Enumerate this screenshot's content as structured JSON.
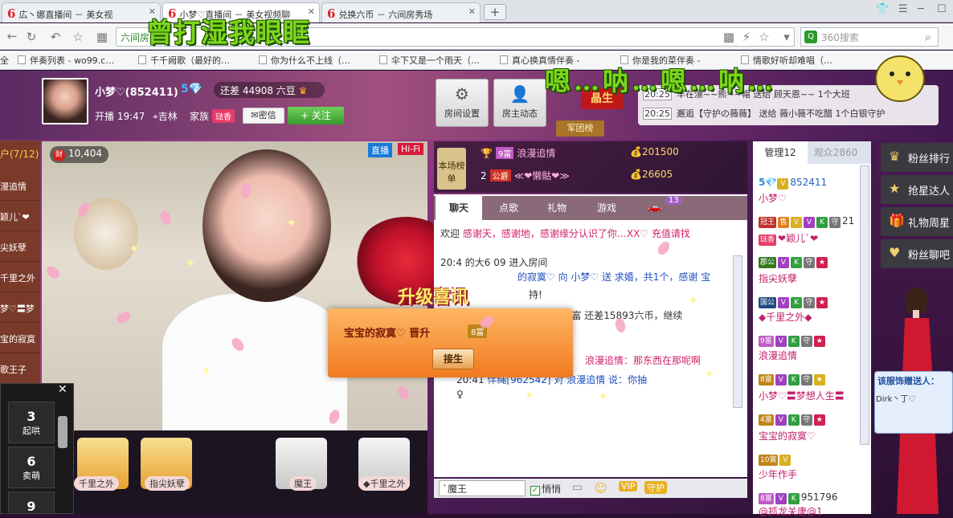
{
  "browser": {
    "tabs": [
      {
        "label": "広丶娜直播间 － 美女视",
        "active": false
      },
      {
        "label": "小梦♡直播间 － 美女视频聊",
        "active": true
      },
      {
        "label": "兑换六币 － 六间房秀场",
        "active": false
      }
    ],
    "new_tab": "+",
    "url": "六间房",
    "search_placeholder": "360搜索",
    "bookmarks": [
      "全",
      "伴奏列表 - wo99.c…",
      "千千阙歌（最好的…",
      "你为什么不上线（…",
      "伞下又是一个雨天（…",
      "真心换真情伴奏 -",
      "你是我的菜伴奏 -",
      "情歌好听却难唱（…"
    ]
  },
  "overlay": {
    "title": "曾打湿我眼眶",
    "subtitle": "嗯…呐…嗯…呐…"
  },
  "host": {
    "name": "小梦♡(852411)",
    "level": "5",
    "gap_text": "还差 44908 六豆",
    "open_time": "开播 19:47",
    "location": "吉林",
    "family_label": "家族",
    "family_badge": "琺香",
    "message_button": "密信",
    "follow_button": "+ 关注"
  },
  "header_buttons": {
    "room_settings": "房间设置",
    "host_feed": "房主动态"
  },
  "rank_badge": "晶生",
  "military_rank": "军团榜",
  "ticker": [
    {
      "time": "20:25",
      "text": "羊在漂~~熊~~帽 送给 顾天恩~~ 1个大班"
    },
    {
      "time": "20:25",
      "text": "邂逅【守护の薇薇】 送给 薇小薇不吃醋 1个白银守护"
    }
  ],
  "left_column": {
    "header": "户(7/12)",
    "items": [
      "漫追情",
      "颖儿`❤",
      "尖妖孽",
      "千里之外",
      "梦♡〓梦",
      "宝的寂寞",
      "歌王子"
    ]
  },
  "video": {
    "wealth": "10,404",
    "wealth_icon": "财",
    "live_tag": "直播",
    "hifi_tag": "Hi-Fi"
  },
  "keypad": {
    "close": "✕",
    "keys": [
      {
        "num": "3",
        "label": "起哄"
      },
      {
        "num": "6",
        "label": "卖萌"
      },
      {
        "num": "9",
        "label": ""
      }
    ]
  },
  "gift_tray": [
    {
      "label": "千里之外"
    },
    {
      "label": "指尖妖孽"
    },
    {
      "label": "魔王"
    },
    {
      "label": "◆千里之外"
    }
  ],
  "board": {
    "label": "本场榜单",
    "rows": [
      {
        "rank": "1",
        "level": "9富",
        "name": "浪漫追情",
        "points": "201500"
      },
      {
        "rank": "2",
        "level": "公爵",
        "name": "≪❤懒骷❤≫",
        "points": "26605"
      }
    ]
  },
  "chat": {
    "tabs": [
      "聊天",
      "点歌",
      "礼物",
      "游戏"
    ],
    "car_count": "13",
    "lines": [
      {
        "a": "欢迎",
        "b": "感谢天，感谢地，感谢缘分认识了你…XX♡ 充值请找"
      },
      {
        "a": "20:4",
        "b": "的大6 09 进入房间"
      },
      {
        "a": "",
        "b": "的寂寞♡ 向 小梦♡ 送 求婚，共1个，感谢 宝"
      },
      {
        "a": "",
        "b": "持!"
      },
      {
        "a": "",
        "b": "距 7富 还差15893六币，继续"
      },
      {
        "a": "",
        "b": "浪漫追情：那东西在那呢啊"
      },
      {
        "a": "20:41",
        "b": "伴绳[962542] 对 浪漫追情 说：你抽"
      },
      {
        "a": "",
        "b": "♀"
      }
    ],
    "input_value": "`魔王",
    "quiet_label": "悄悄",
    "vip_label": "VIP",
    "guard_label": "守护"
  },
  "popup": {
    "title": "升级喜讯",
    "text": "宝宝的寂寞♡ 晋升",
    "badge": "8富",
    "accept": "接生"
  },
  "members": {
    "tabs": [
      {
        "label": "管理12",
        "active": true
      },
      {
        "label": "观众2860",
        "active": false
      }
    ],
    "list": [
      {
        "level": "5",
        "id": "852411",
        "name": "小梦♡"
      },
      {
        "level": "冠王",
        "id": "21",
        "name": "❤颖儿`❤",
        "tag": "琺香"
      },
      {
        "level": "郡公",
        "id": "",
        "name": "指尖妖孽"
      },
      {
        "level": "国公",
        "id": "",
        "name": "◆千里之外◆"
      },
      {
        "level": "9富",
        "id": "",
        "name": "浪漫追情"
      },
      {
        "level": "8富",
        "id": "",
        "name": "小梦♡〓梦想人生〓"
      },
      {
        "level": "4富",
        "id": "",
        "name": "宝宝的寂寞♡"
      },
      {
        "level": "10富",
        "id": "",
        "name": "少年作手"
      },
      {
        "level": "8富",
        "id": "951796",
        "name": "@抓龙关唐@1"
      }
    ]
  },
  "right_sidebar": {
    "buttons": [
      "粉丝排行",
      "抢星达人",
      "礼物周星",
      "粉丝聊吧"
    ],
    "giver_title": "该服饰赠送人：",
    "giver_name": "Dirk丶丁♡"
  },
  "colors": {
    "accent_green": "#7cd61c",
    "brand_red": "#e0202a",
    "member_pink": "#c0206a"
  }
}
